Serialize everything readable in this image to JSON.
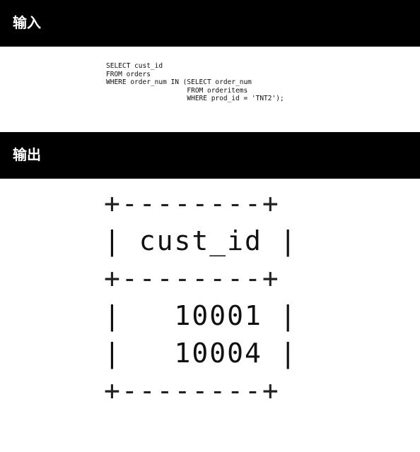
{
  "sections": {
    "input_label": "输入",
    "output_label": "输出"
  },
  "sql": {
    "lines": [
      "SELECT cust_id",
      "FROM orders",
      "WHERE order_num IN (SELECT order_num",
      "                    FROM orderitems",
      "                    WHERE prod_id = 'TNT2');"
    ]
  },
  "result": {
    "border_top": "+--------+",
    "header_row": "| cust_id |",
    "border_mid": "+--------+",
    "rows": [
      "|   10001 |",
      "|   10004 |"
    ],
    "border_bottom": "+--------+"
  }
}
